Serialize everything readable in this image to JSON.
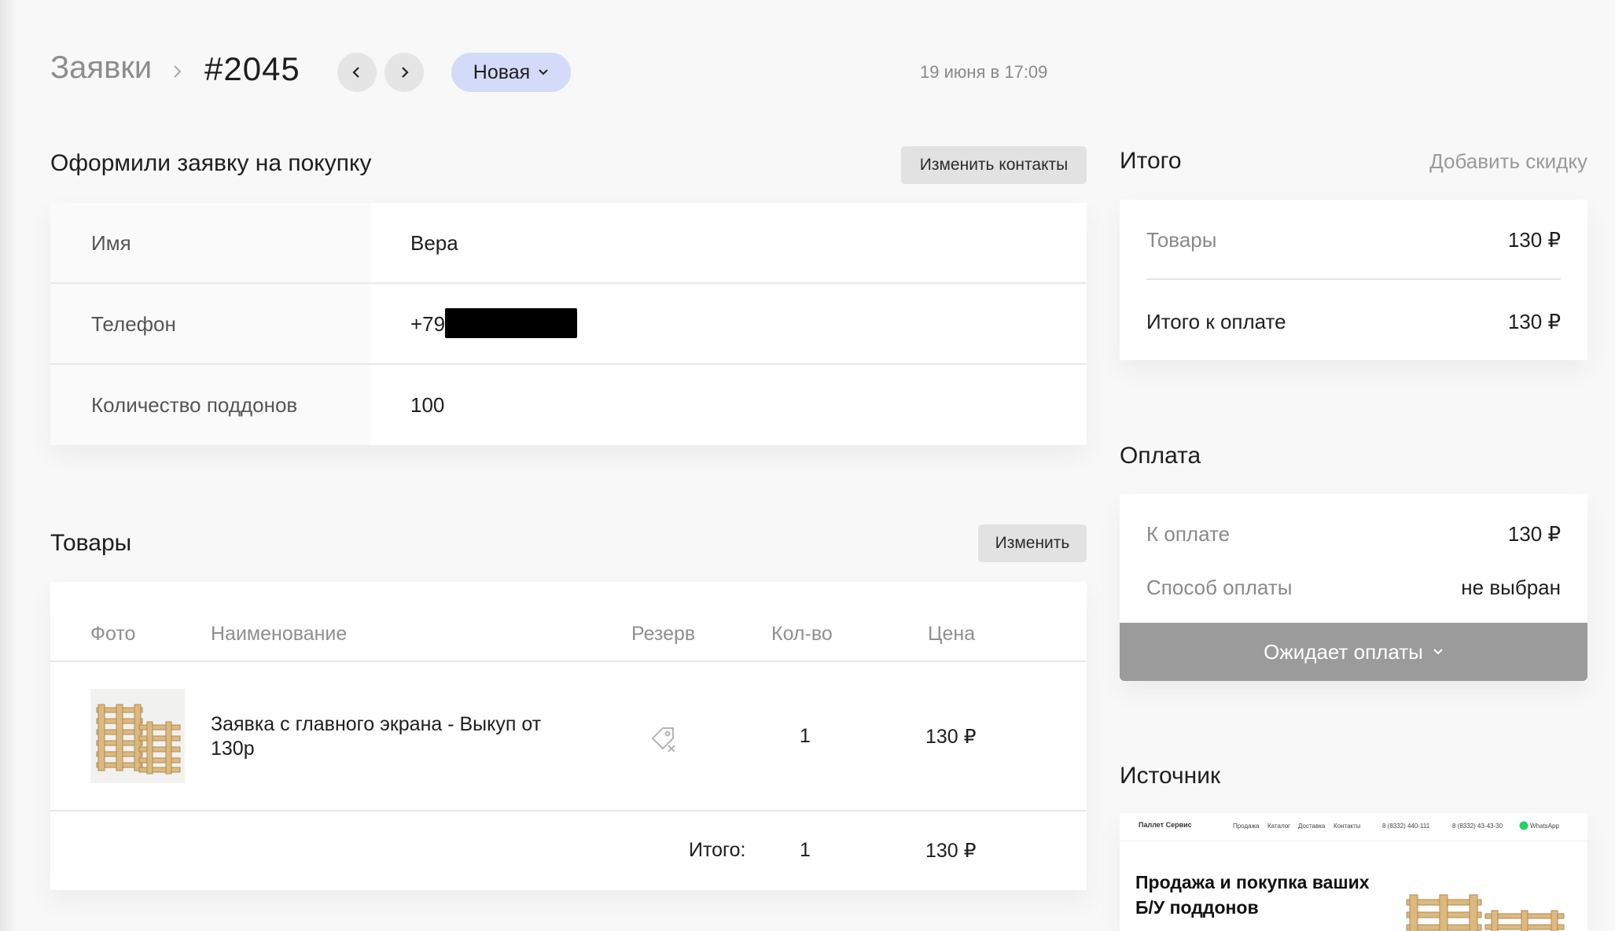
{
  "header": {
    "breadcrumb": "Заявки",
    "order_number": "#2045",
    "status": "Новая",
    "date": "19 июня в 17:09"
  },
  "request": {
    "title": "Оформили заявку на покупку",
    "edit_button": "Изменить контакты",
    "fields": [
      {
        "label": "Имя",
        "value": "Вера"
      },
      {
        "label": "Телефон",
        "value": "+79"
      },
      {
        "label": "Количество поддонов",
        "value": "100"
      }
    ]
  },
  "goods": {
    "title": "Товары",
    "edit_button": "Изменить",
    "columns": [
      "Фото",
      "Наименование",
      "Резерв",
      "Кол-во",
      "Цена"
    ],
    "items": [
      {
        "name": "Заявка с главного экрана - Выкуп от 130р",
        "qty": "1",
        "price": "130 ₽",
        "reserve_icon": "tag-off-icon",
        "photo_icon": "pallet-stack-icon"
      }
    ],
    "total_label": "Итого:",
    "total_qty": "1",
    "total_price": "130 ₽"
  },
  "summary": {
    "title": "Итого",
    "add_discount": "Добавить скидку",
    "goods_label": "Товары",
    "goods_value": "130 ₽",
    "total_label": "Итого к оплате",
    "total_value": "130 ₽"
  },
  "payment": {
    "title": "Оплата",
    "due_label": "К оплате",
    "due_value": "130 ₽",
    "method_label": "Способ оплаты",
    "method_value": "не выбран",
    "status": "Ожидает оплаты"
  },
  "source": {
    "title": "Источник",
    "preview": {
      "logo": "Паллет Сервис",
      "nav": [
        "Продажа",
        "Каталог",
        "Доставка",
        "Контакты"
      ],
      "phone1": "8 (8332) 440-111",
      "phone2": "8 (8332) 43-43-30",
      "messenger": "WhatsApp",
      "headline": "Продажа и покупка ваших Б/У поддонов"
    }
  },
  "colors": {
    "background": "#f8f8f8",
    "status_pill": "#d4dbf9",
    "pay_status": "#9b9b9b",
    "button_gray": "#e2e2e2"
  }
}
